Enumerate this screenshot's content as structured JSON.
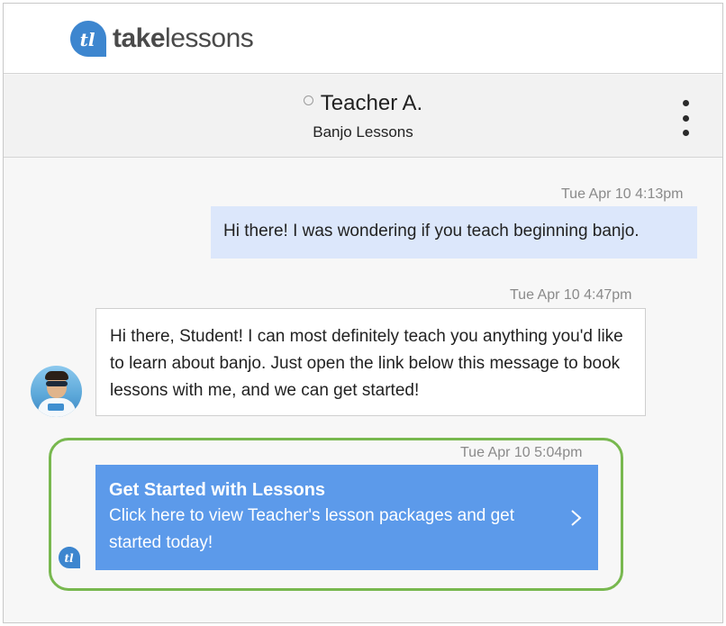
{
  "brand": {
    "logo_icon": "tl-logo-icon",
    "name_strong": "take",
    "name_light": "lessons",
    "color_blue": "#3d86cf"
  },
  "header": {
    "teacher_name": "Teacher A.",
    "course": "Banjo Lessons",
    "status": "offline",
    "menu_icon": "vertical-ellipsis-icon"
  },
  "messages": [
    {
      "sender": "student",
      "timestamp": "Tue Apr 10 4:13pm",
      "text": "Hi there! I was wondering if you teach beginning banjo."
    },
    {
      "sender": "teacher",
      "timestamp": "Tue Apr 10 4:47pm",
      "text": "Hi there, Student! I can most definitely teach you anything you'd like to learn about banjo. Just open the link below this message to book lessons with me, and we can get started!"
    },
    {
      "sender": "takelessons",
      "timestamp": "Tue Apr 10 5:04pm",
      "title": "Get Started with Lessons",
      "text": "Click here to view Teacher's lesson packages and get started today!"
    }
  ],
  "colors": {
    "student_bubble": "#dce7fb",
    "cta_background": "#5c9aea",
    "highlight_border": "#78b84f"
  }
}
